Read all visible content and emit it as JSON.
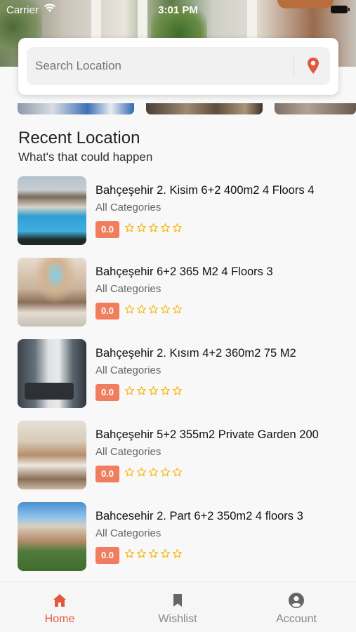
{
  "status_bar": {
    "carrier": "Carrier",
    "time": "3:01 PM"
  },
  "search": {
    "placeholder": "Search Location"
  },
  "recent": {
    "title": "Recent Location",
    "subtitle": "What's that could happen"
  },
  "items": [
    {
      "title": "Bahçeşehir 2. Kisim 6+2 400m2 4 Floors 4",
      "category": "All Categories",
      "rating": "0.0",
      "stars": 0
    },
    {
      "title": "Bahçeşehir  6+2 365 M2 4 Floors 3",
      "category": "All Categories",
      "rating": "0.0",
      "stars": 0
    },
    {
      "title": "Bahçeşehir 2. Kısım 4+2 360m2 75 M2",
      "category": "All Categories",
      "rating": "0.0",
      "stars": 0
    },
    {
      "title": "Bahçeşehir 5+2 355m2 Private Garden 200",
      "category": "All Categories",
      "rating": "0.0",
      "stars": 0
    },
    {
      "title": "Bahcesehir 2. Part 6+2 350m2 4 floors 3",
      "category": "All Categories",
      "rating": "0.0",
      "stars": 0
    }
  ],
  "nav": {
    "home": "Home",
    "wishlist": "Wishlist",
    "account": "Account",
    "active": "home"
  },
  "colors": {
    "accent": "#e3583b",
    "badge": "#f07e5e",
    "star": "#f4b400"
  }
}
